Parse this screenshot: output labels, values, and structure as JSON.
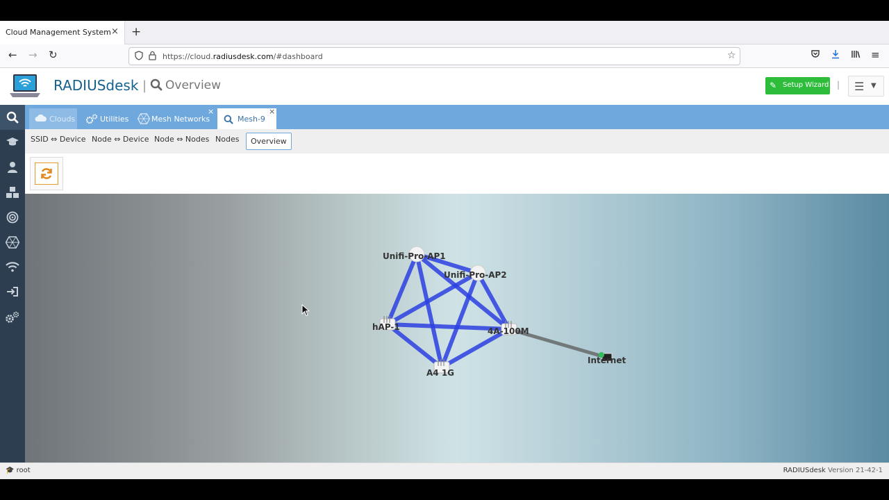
{
  "browser": {
    "tab_title": "Cloud Management System",
    "tab_close": "×",
    "new_tab": "+",
    "url_host_prefix": "https://cloud.",
    "url_host": "radiusdesk.com",
    "url_path": "/#dashboard"
  },
  "header": {
    "brand": "RADIUSdesk",
    "separator": "|",
    "page_title": "Overview",
    "setup_wizard_label": "Setup Wizard",
    "menu_separator": "|"
  },
  "sidebar": {
    "icons": [
      "search-icon",
      "graduation-cap-icon",
      "user-icon",
      "cubes-icon",
      "bullseye-icon",
      "hexagon-icon",
      "wifi-icon",
      "sign-in-icon",
      "gears-icon"
    ]
  },
  "module_tabs": [
    {
      "label": "Clouds",
      "icon": "cloud-icon",
      "state": "pressed"
    },
    {
      "label": "Utilities",
      "icon": "gears-icon"
    },
    {
      "label": "Mesh Networks",
      "icon": "hexagon-icon",
      "closable": true
    },
    {
      "label": "Mesh-9",
      "icon": "search-icon",
      "closable": true,
      "state": "active"
    }
  ],
  "tab_close_glyph": "×",
  "sub_tabs": [
    {
      "label": "SSID ⇔ Device"
    },
    {
      "label": "Node ⇔ Device"
    },
    {
      "label": "Node ⇔ Nodes"
    },
    {
      "label": "Nodes"
    },
    {
      "label": "Overview",
      "active": true
    }
  ],
  "graph": {
    "nodes": [
      {
        "id": "ap1",
        "label": "Unifi-Pro-AP1"
      },
      {
        "id": "ap2",
        "label": "Unifi-Pro-AP2"
      },
      {
        "id": "hap",
        "label": "hAP-1"
      },
      {
        "id": "g100",
        "label": "4A-100M"
      },
      {
        "id": "g1g",
        "label": "A4 1G"
      },
      {
        "id": "inet",
        "label": "Internet"
      }
    ],
    "links": [
      {
        "from": "ap1",
        "to": "ap2",
        "kind": "mesh"
      },
      {
        "from": "ap1",
        "to": "hap",
        "kind": "mesh"
      },
      {
        "from": "ap1",
        "to": "g100",
        "kind": "mesh"
      },
      {
        "from": "ap1",
        "to": "g1g",
        "kind": "mesh"
      },
      {
        "from": "ap2",
        "to": "hap",
        "kind": "mesh"
      },
      {
        "from": "ap2",
        "to": "g100",
        "kind": "mesh"
      },
      {
        "from": "ap2",
        "to": "g1g",
        "kind": "mesh"
      },
      {
        "from": "hap",
        "to": "g100",
        "kind": "mesh"
      },
      {
        "from": "hap",
        "to": "g1g",
        "kind": "mesh"
      },
      {
        "from": "g1g",
        "to": "g100",
        "kind": "mesh"
      },
      {
        "from": "g100",
        "to": "inet",
        "kind": "gateway"
      }
    ],
    "colors": {
      "mesh": "#2b3fe0",
      "gateway": "#6a6f70"
    }
  },
  "status": {
    "user": "root",
    "app_name": "RADIUSdesk",
    "version": "Version 21-42-1"
  }
}
